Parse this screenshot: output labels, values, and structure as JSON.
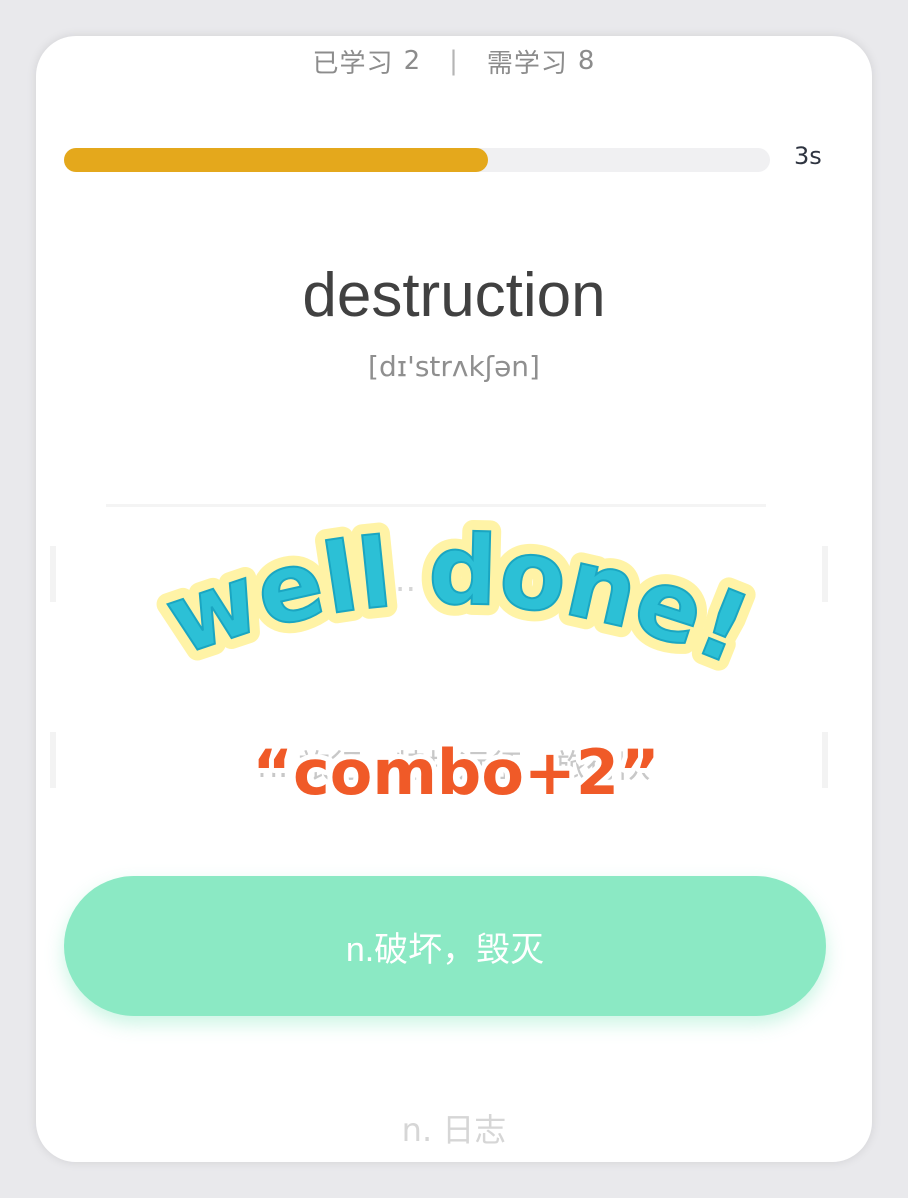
{
  "header": {
    "learned_label": "已学习",
    "learned_count": "2",
    "separator": "|",
    "remaining_label": "需学习",
    "remaining_count": "8"
  },
  "progress": {
    "value": 0.6,
    "timer": "3s",
    "color": "#e4a81c"
  },
  "word": {
    "text": "destruction",
    "phonetic": "[dɪ'strʌkʃən]"
  },
  "options": [
    {
      "text": "n. 信… 可… 可信性"
    },
    {
      "text": "n. 旅行，特指远征，旅行队"
    },
    {
      "text": "n.破坏，毁灭"
    },
    {
      "text": "n. 日志"
    }
  ],
  "feedback": {
    "title": "well done!",
    "combo": "“combo+2”",
    "title_color": "#2cc0d6",
    "combo_color": "#f05a28"
  },
  "colors": {
    "answer_button": "#8be9c4"
  }
}
